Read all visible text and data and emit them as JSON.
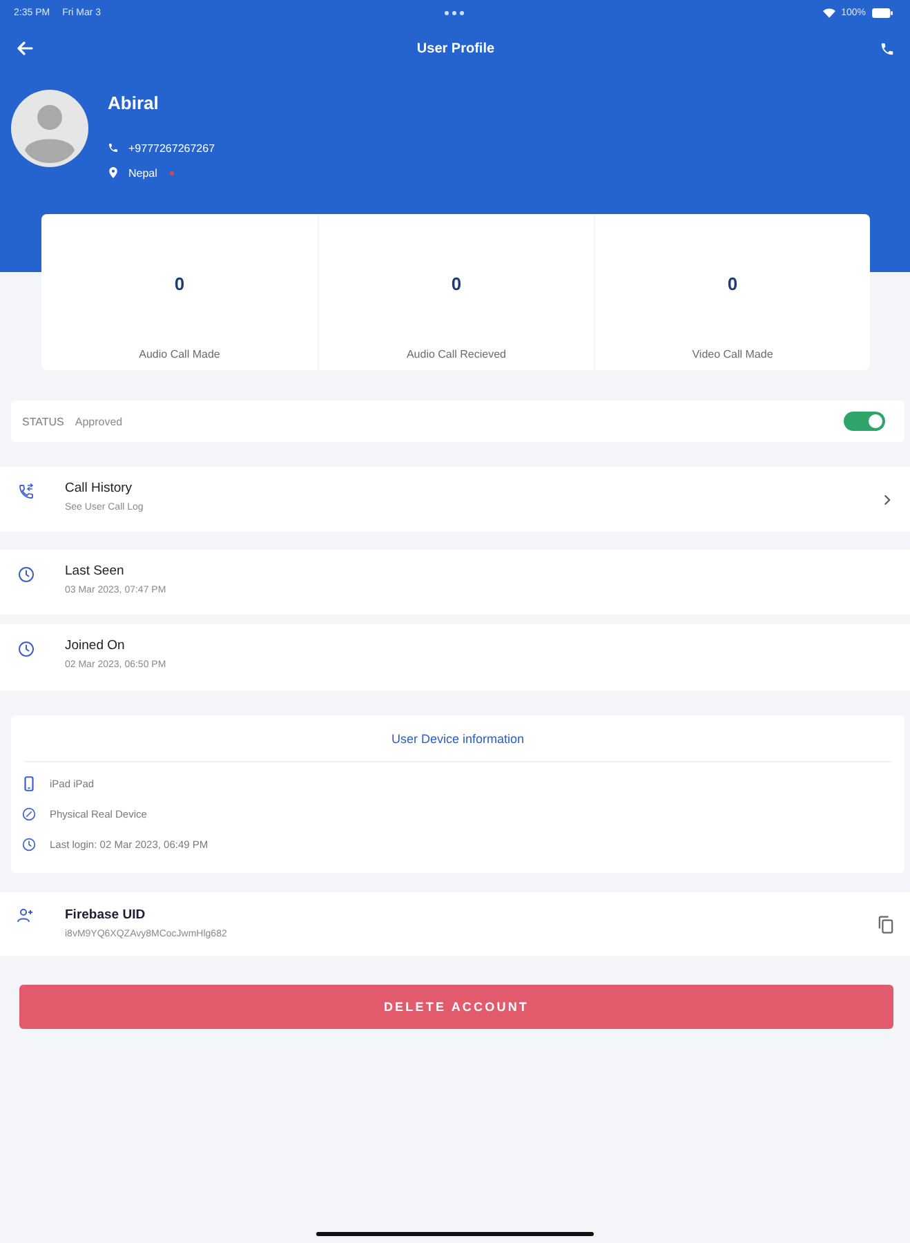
{
  "status_bar": {
    "time": "2:35 PM",
    "date": "Fri Mar 3",
    "battery": "100%"
  },
  "header": {
    "title": "User Profile"
  },
  "profile": {
    "name": "Abiral",
    "phone": "+9777267267267",
    "location": "Nepal"
  },
  "stats": [
    {
      "value": "0",
      "label": "Audio Call Made"
    },
    {
      "value": "0",
      "label": "Audio Call Recieved"
    },
    {
      "value": "0",
      "label": "Video Call Made"
    }
  ],
  "status": {
    "label": "STATUS",
    "value": "Approved",
    "on": true
  },
  "rows": [
    {
      "kind": "link",
      "title": "Call History",
      "subtitle": "See User Call Log"
    },
    {
      "kind": "clock",
      "title": "Last Seen",
      "subtitle": "03 Mar 2023, 07:47 PM"
    },
    {
      "kind": "clock",
      "title": "Joined On",
      "subtitle": "02 Mar 2023, 06:50 PM"
    }
  ],
  "device_info": {
    "title": "User Device information",
    "items": [
      {
        "kind": "device",
        "text": "iPad iPad"
      },
      {
        "kind": "check",
        "text": "Physical Real Device"
      },
      {
        "kind": "clock",
        "text": "Last login: 02 Mar 2023, 06:49 PM"
      }
    ]
  },
  "firebase": {
    "title": "Firebase UID",
    "value": "i8vM9YQ6XQZAvy8MCocJwmHlg682"
  },
  "delete_button": {
    "label": "DELETE ACCOUNT"
  }
}
